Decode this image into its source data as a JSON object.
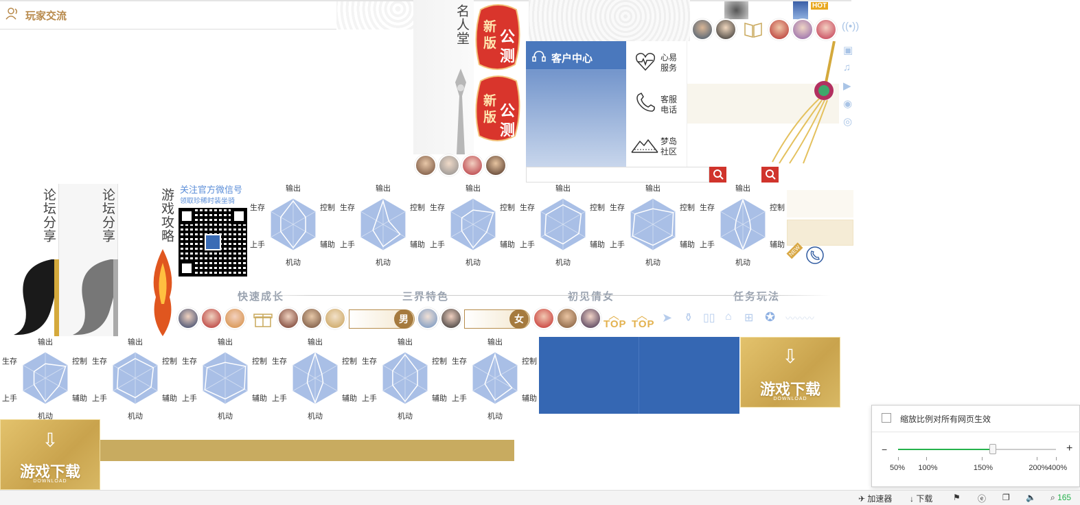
{
  "header": {
    "title": "玩家交流"
  },
  "hall": {
    "title": "名人堂"
  },
  "badges": [
    {
      "line1": "新",
      "line2": "版",
      "big1": "公",
      "big2": "测"
    },
    {
      "line1": "新",
      "line2": "版",
      "big1": "公",
      "big2": "测"
    }
  ],
  "customer_center": {
    "title": "客户中心",
    "items": [
      {
        "label": "心易\n服务",
        "icon": "heartbeat-icon"
      },
      {
        "label": "客服\n电话",
        "icon": "phone-icon"
      },
      {
        "label": "梦岛\n社区",
        "icon": "mountain-icon"
      }
    ]
  },
  "side_tabs": [
    {
      "label": "论坛分享"
    },
    {
      "label": "论坛分享"
    },
    {
      "label": "游戏攻略"
    }
  ],
  "wechat": {
    "line1": "关注官方微信号",
    "line2": "领取珍稀时装坐骑"
  },
  "radar_labels": {
    "top": "输出",
    "left_top": "生存",
    "right_top": "控制",
    "left_bottom": "上手",
    "right_bottom": "辅助",
    "bottom": "机动"
  },
  "sections": [
    "快速成长",
    "三界特色",
    "初见倩女",
    "任务玩法"
  ],
  "gender": {
    "male": "男",
    "female": "女"
  },
  "top_labels": [
    "TOP",
    "TOP"
  ],
  "badges_misc": {
    "hot": "HOT",
    "new": "NEW"
  },
  "download": {
    "label": "游戏下载",
    "sub": "DOWNLOAD"
  },
  "zoom_popup": {
    "checkbox_label": "缩放比例对所有网页生效",
    "minus": "−",
    "plus": "+",
    "ticks": [
      "50%",
      "100%",
      "150%",
      "200%",
      "400%"
    ],
    "value_fraction": 0.6
  },
  "status_bar": {
    "accelerator": "加速器",
    "download": "下载",
    "zoom": "165"
  },
  "colors": {
    "accent_red": "#d0342c",
    "gold": "#c9a85c",
    "blue_panel": "#3567b3",
    "green": "#24b24b"
  }
}
